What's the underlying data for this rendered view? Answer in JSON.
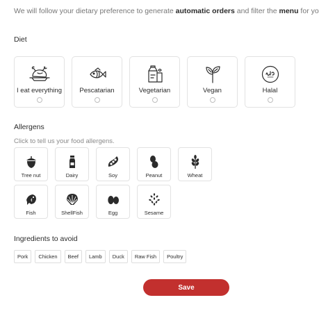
{
  "intro": {
    "part1": "We will follow your dietary preference to generate ",
    "bold1": "automatic orders",
    "part2": " and filter the ",
    "bold2": "menu",
    "part3": " for you."
  },
  "diet": {
    "title": "Diet",
    "options": [
      {
        "label": "I eat everything",
        "icon": "roast-chicken-icon",
        "selected": false
      },
      {
        "label": "Pescatarian",
        "icon": "fish-icon",
        "selected": false
      },
      {
        "label": "Vegetarian",
        "icon": "milk-carton-icon",
        "selected": false
      },
      {
        "label": "Vegan",
        "icon": "sprout-icon",
        "selected": false
      },
      {
        "label": "Halal",
        "icon": "halal-icon",
        "selected": false
      }
    ]
  },
  "allergens": {
    "title": "Allergens",
    "hint": "Click to tell us your food allergens.",
    "items": [
      {
        "label": "Tree nut",
        "icon": "acorn-icon"
      },
      {
        "label": "Dairy",
        "icon": "milk-bottle-icon"
      },
      {
        "label": "Soy",
        "icon": "soybean-icon"
      },
      {
        "label": "Peanut",
        "icon": "peanut-icon"
      },
      {
        "label": "Wheat",
        "icon": "wheat-icon"
      },
      {
        "label": "Fish",
        "icon": "fish-icon"
      },
      {
        "label": "ShellFish",
        "icon": "shell-icon"
      },
      {
        "label": "Egg",
        "icon": "egg-icon"
      },
      {
        "label": "Sesame",
        "icon": "sesame-icon"
      }
    ]
  },
  "ingredients": {
    "title": "Ingredients to avoid",
    "items": [
      "Pork",
      "Chicken",
      "Beef",
      "Lamb",
      "Duck",
      "Raw Fish",
      "Poultry"
    ]
  },
  "save_label": "Save",
  "colors": {
    "accent": "#c2302e",
    "border": "#e2e2e2",
    "muted_text": "#777777"
  }
}
